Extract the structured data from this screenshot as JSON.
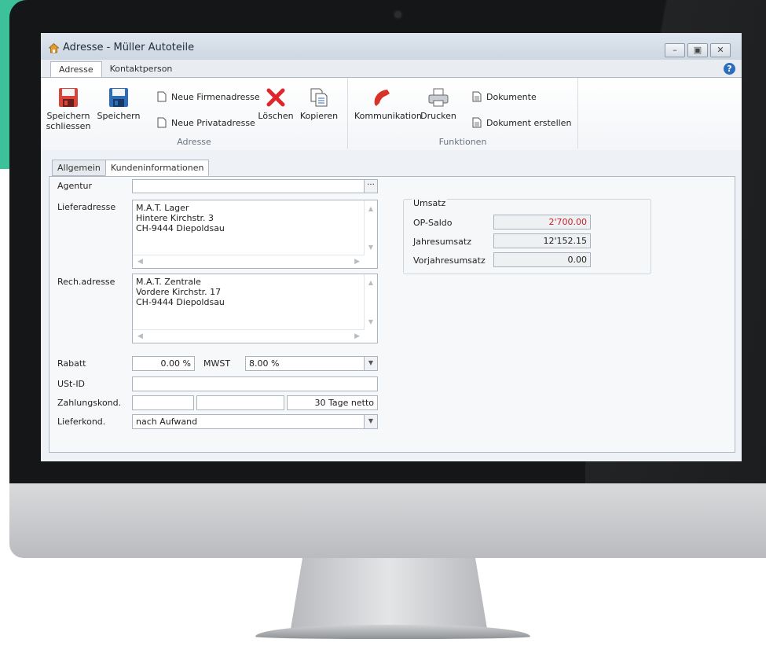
{
  "window": {
    "title": "Adresse - Müller Autoteile"
  },
  "top_tabs": [
    "Adresse",
    "Kontaktperson"
  ],
  "ribbon": {
    "adresse_group": {
      "label": "Adresse",
      "speichern_schliessen": [
        "Speichern",
        "schliessen"
      ],
      "speichern": "Speichern",
      "neue_firmenadresse": "Neue Firmenadresse",
      "neue_privatadresse": "Neue Privatadresse",
      "loeschen": "Löschen",
      "kopieren": "Kopieren"
    },
    "funktionen_group": {
      "label": "Funktionen",
      "kommunikation": "Kommunikation",
      "drucken": "Drucken",
      "dokumente": "Dokumente",
      "dokument_erstellen": "Dokument erstellen"
    }
  },
  "sub_tabs": [
    "Allgemein",
    "Kundeninformationen"
  ],
  "form": {
    "agentur_label": "Agentur",
    "agentur_value": "",
    "lieferadresse_label": "Lieferadresse",
    "lieferadresse_lines": [
      "M.A.T. Lager",
      "Hintere Kirchstr. 3",
      "CH-9444 Diepoldsau"
    ],
    "rechadresse_label": "Rech.adresse",
    "rechadresse_lines": [
      "M.A.T. Zentrale",
      "Vordere Kirchstr. 17",
      "CH-9444 Diepoldsau"
    ],
    "rabatt_label": "Rabatt",
    "rabatt_value": "0.00 %",
    "mwst_label": "MWST",
    "mwst_value": "8.00 %",
    "ustid_label": "USt-ID",
    "ustid_value": "",
    "zahlungskond_label": "Zahlungskond.",
    "zahlungskond_values": [
      "",
      "",
      "30 Tage netto"
    ],
    "lieferkond_label": "Lieferkond.",
    "lieferkond_value": "nach Aufwand"
  },
  "umsatz": {
    "title": "Umsatz",
    "op_saldo_label": "OP-Saldo",
    "op_saldo_value": "2'700.00",
    "jahresumsatz_label": "Jahresumsatz",
    "jahresumsatz_value": "12'152.15",
    "vorjahresumsatz_label": "Vorjahresumsatz",
    "vorjahresumsatz_value": "0.00"
  },
  "colors": {
    "accent_teal": "#3cc19a",
    "negative_red": "#c0262d",
    "delete_red": "#e0262a",
    "save_red": "#d9443a",
    "save_blue": "#2d6db8",
    "phone_red": "#d8332b"
  }
}
